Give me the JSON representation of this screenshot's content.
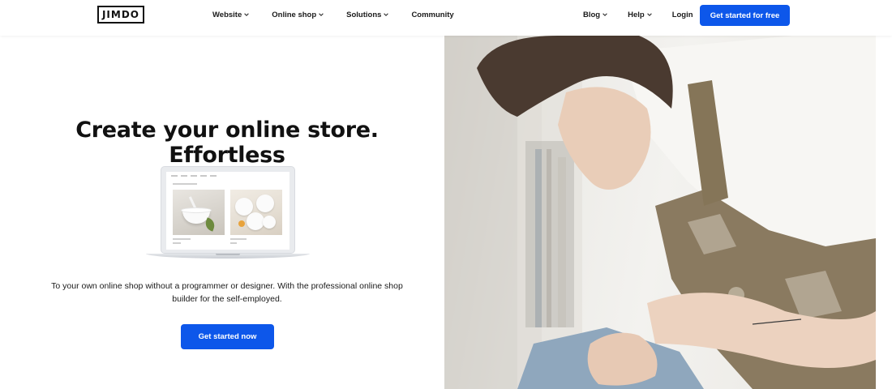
{
  "header": {
    "logo": "JIMDO",
    "nav_left": [
      {
        "label": "Website",
        "has_dropdown": true
      },
      {
        "label": "Online shop",
        "has_dropdown": true
      },
      {
        "label": "Solutions",
        "has_dropdown": true
      },
      {
        "label": "Community",
        "has_dropdown": false
      }
    ],
    "nav_right": [
      {
        "label": "Blog",
        "has_dropdown": true
      },
      {
        "label": "Help",
        "has_dropdown": true
      },
      {
        "label": "Login",
        "has_dropdown": false
      }
    ],
    "cta": "Get started for free"
  },
  "hero": {
    "title_regular": "Create your online store.",
    "title_bold": "Effortless",
    "description_line1": "To your own online shop without a programmer or designer. With the professional online shop",
    "description_line2": "builder for the self-employed.",
    "cta": "Get started now"
  },
  "colors": {
    "accent": "#0d57ea",
    "text": "#1a1a1a",
    "background": "#ffffff"
  },
  "icons": {
    "dropdown": "chevron-down-icon"
  }
}
